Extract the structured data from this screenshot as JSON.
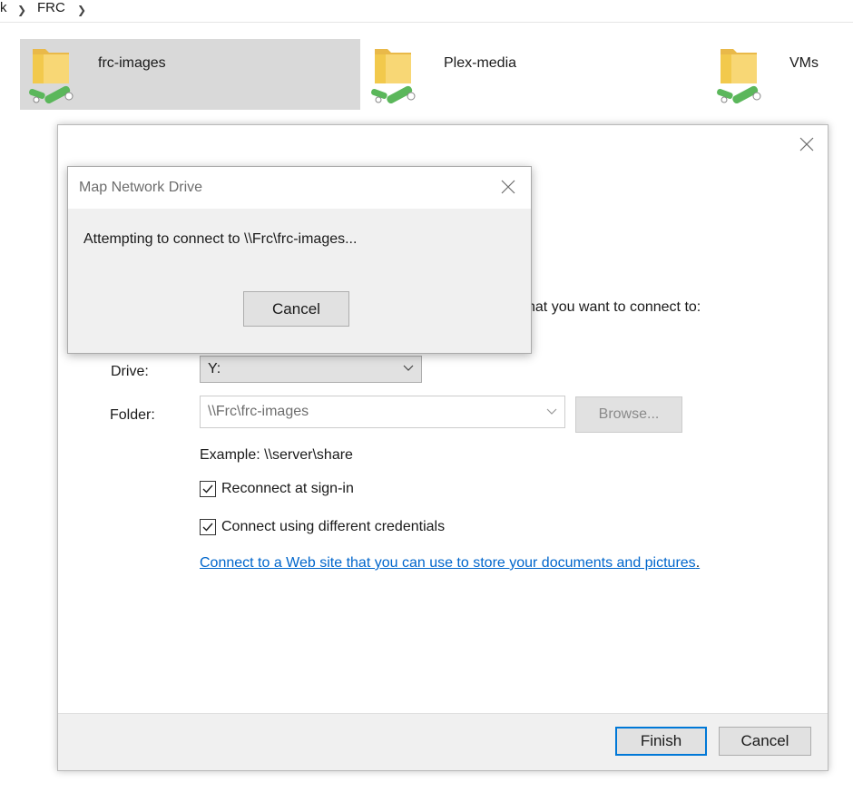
{
  "breadcrumb": {
    "prev_fragment": "k",
    "current": "FRC"
  },
  "folders": [
    {
      "name": "frc-images",
      "selected": true,
      "icon": "network-folder-icon"
    },
    {
      "name": "Plex-media",
      "selected": false,
      "icon": "network-folder-icon"
    },
    {
      "name": "VMs",
      "selected": false,
      "icon": "network-folder-icon"
    }
  ],
  "wizard": {
    "instruction_tail": "hat you want to connect to:",
    "drive_label": "Drive:",
    "drive_value": "Y:",
    "folder_label": "Folder:",
    "folder_value": "\\\\Frc\\frc-images",
    "browse_label": "Browse...",
    "example_text": "Example: \\\\server\\share",
    "reconnect_label": "Reconnect at sign-in",
    "reconnect_checked": true,
    "credentials_label": "Connect using different credentials",
    "credentials_checked": true,
    "web_link": "Connect to a Web site that you can use to store your documents and pictures",
    "link_suffix": ".",
    "finish_label": "Finish",
    "cancel_label": "Cancel"
  },
  "popup": {
    "title": "Map Network Drive",
    "message": "Attempting to connect to \\\\Frc\\frc-images...",
    "cancel_label": "Cancel"
  },
  "colors": {
    "accent": "#0078d7",
    "link": "#0066cc",
    "selected_tile": "#d9d9d9",
    "folder_yellow": "#f8d775",
    "network_green": "#5bb75b"
  }
}
